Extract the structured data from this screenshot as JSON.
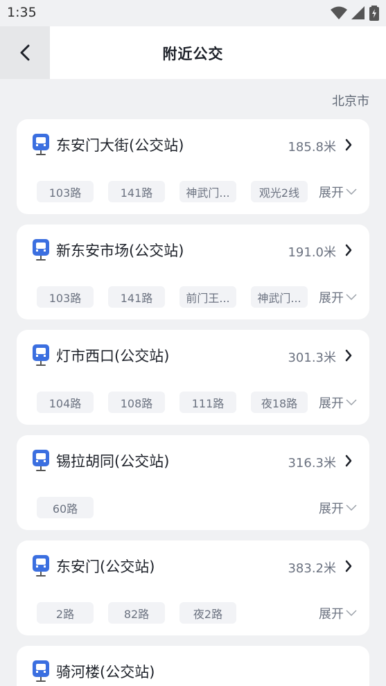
{
  "status_bar": {
    "time": "1:35"
  },
  "header": {
    "title": "附近公交"
  },
  "city": "北京市",
  "expand_label": "展开",
  "colors": {
    "accent": "#3b6fe0",
    "card_bg": "#ffffff",
    "page_bg": "#f0f1f3",
    "tag_bg": "#f2f3f6"
  },
  "stops": [
    {
      "name": "东安门大街(公交站)",
      "distance": "185.8米",
      "routes": [
        "103路",
        "141路",
        "神武门...",
        "观光2线"
      ]
    },
    {
      "name": "新东安市场(公交站)",
      "distance": "191.0米",
      "routes": [
        "103路",
        "141路",
        "前门王...",
        "神武门..."
      ]
    },
    {
      "name": "灯市西口(公交站)",
      "distance": "301.3米",
      "routes": [
        "104路",
        "108路",
        "111路",
        "夜18路"
      ]
    },
    {
      "name": "锡拉胡同(公交站)",
      "distance": "316.3米",
      "routes": [
        "60路"
      ]
    },
    {
      "name": "东安门(公交站)",
      "distance": "383.2米",
      "routes": [
        "2路",
        "82路",
        "夜2路"
      ]
    },
    {
      "name": "骑河楼(公交站)"
    }
  ]
}
